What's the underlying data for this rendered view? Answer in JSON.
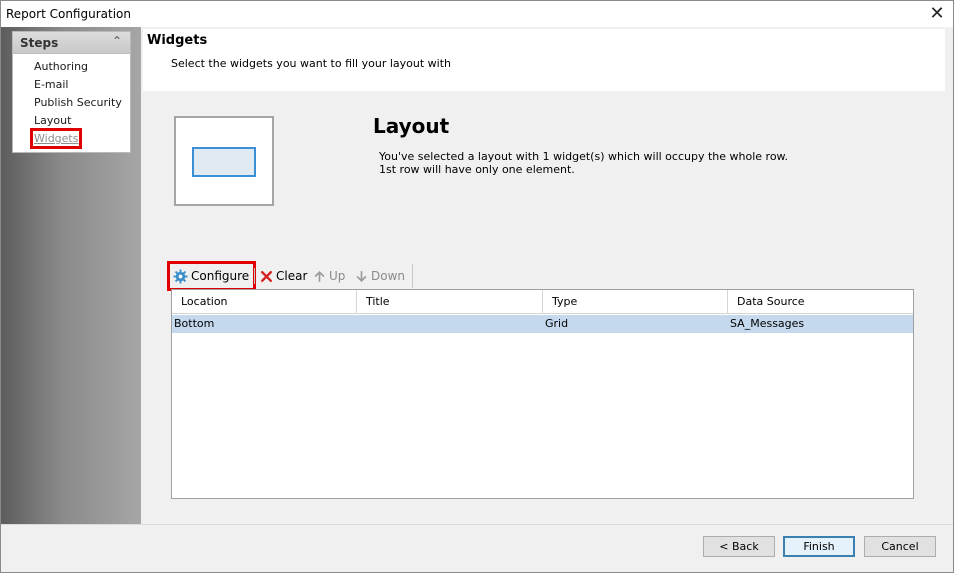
{
  "window": {
    "title": "Report Configuration",
    "close_glyph": "✕"
  },
  "sidebar": {
    "title": "Steps",
    "collapse_glyph": "⌃",
    "items": [
      {
        "label": "Authoring"
      },
      {
        "label": "E-mail"
      },
      {
        "label": "Publish Security"
      },
      {
        "label": "Layout"
      },
      {
        "label": "Widgets",
        "active": true
      }
    ]
  },
  "header": {
    "title": "Widgets",
    "subtitle": "Select the widgets you want to fill your layout with"
  },
  "layout": {
    "title": "Layout",
    "description_line1": "You've selected a layout with 1 widget(s) which will occupy the whole row.",
    "description_line2": "1st row will have only one element."
  },
  "toolbar": {
    "configure_label": "Configure",
    "clear_label": "Clear",
    "up_label": "Up",
    "down_label": "Down",
    "configure_icon": "gear-icon",
    "clear_icon": "x-icon",
    "up_icon": "arrow-up-icon",
    "down_icon": "arrow-down-icon"
  },
  "grid": {
    "columns": [
      "Location",
      "Title",
      "Type",
      "Data Source"
    ],
    "rows": [
      {
        "location": "Bottom",
        "title": "",
        "type": "Grid",
        "data_source": "SA_Messages",
        "selected": true
      }
    ]
  },
  "footer": {
    "back_label": "< Back",
    "finish_label": "Finish",
    "cancel_label": "Cancel"
  },
  "colors": {
    "highlight": "#e00000",
    "selection": "#c5d9ee",
    "accent": "#3b8fd7",
    "gear": "#3a8fc9",
    "clear_x": "#d32020"
  }
}
